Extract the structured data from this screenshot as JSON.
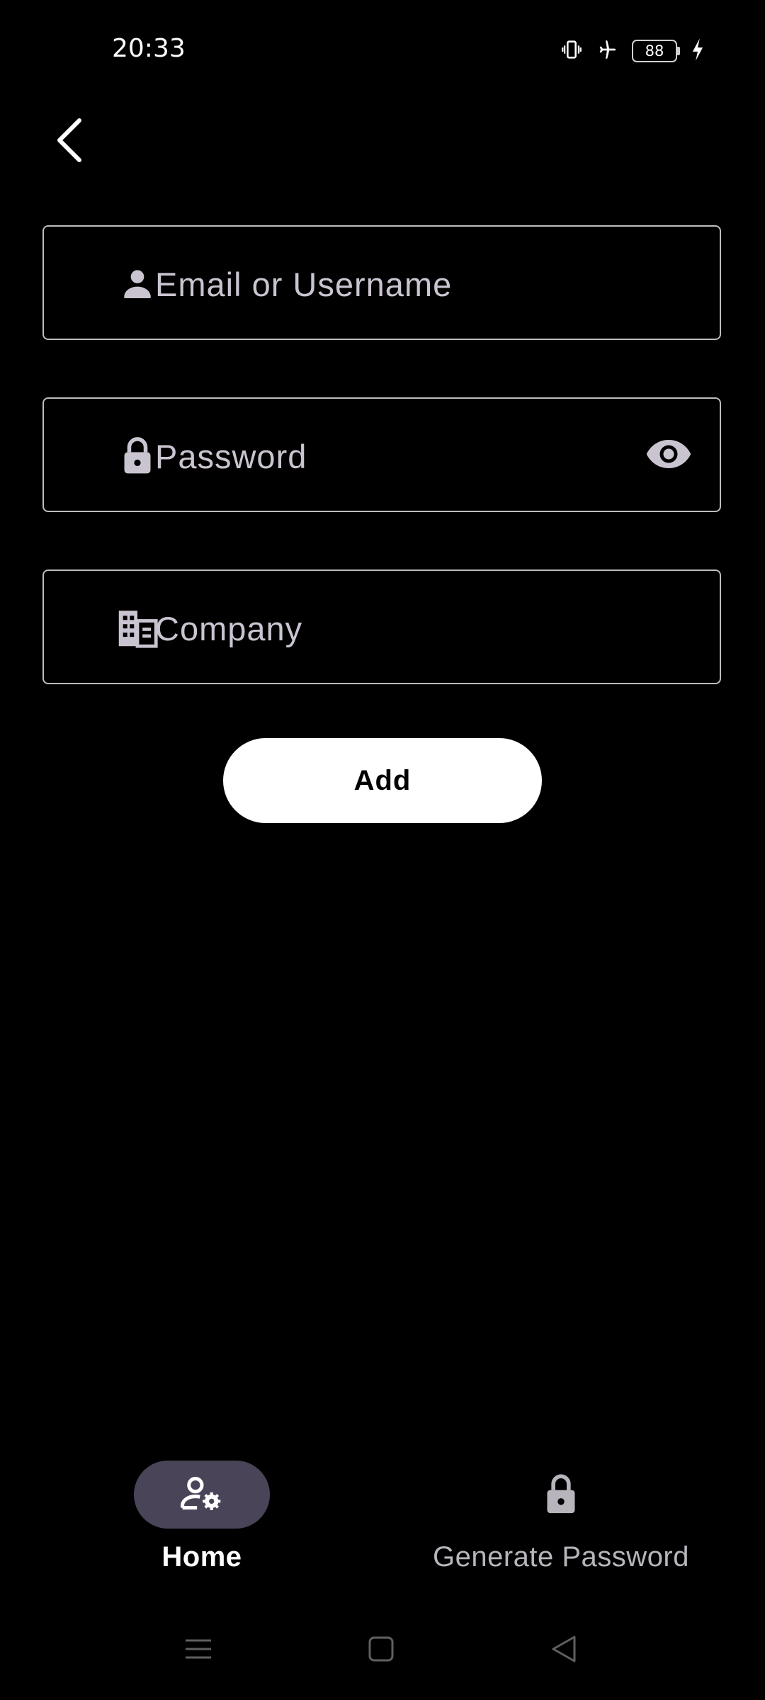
{
  "status_bar": {
    "time": "20:33",
    "battery_level": "88",
    "icons": [
      "vibrate-icon",
      "airplane-mode-icon",
      "battery-icon",
      "charging-icon"
    ]
  },
  "header": {
    "back_icon": "chevron-left-icon"
  },
  "form": {
    "email": {
      "placeholder": "Email or Username",
      "value": "",
      "icon": "person-icon"
    },
    "password": {
      "placeholder": "Password",
      "value": "",
      "icon": "lock-icon",
      "toggle_icon": "eye-icon"
    },
    "company": {
      "placeholder": "Company",
      "value": "",
      "icon": "building-icon"
    },
    "add_label": "Add"
  },
  "bottom_nav": {
    "items": [
      {
        "label": "Home",
        "icon": "user-settings-icon",
        "active": true
      },
      {
        "label": "Generate Password",
        "icon": "lock-icon",
        "active": false
      }
    ]
  },
  "system_nav": [
    "menu-icon",
    "home-square-icon",
    "back-triangle-icon"
  ],
  "colors": {
    "background": "#000000",
    "field_border": "#bdbdbd",
    "placeholder": "#cac4d0",
    "nav_active_pill": "#4a4458",
    "button_bg": "#ffffff"
  }
}
